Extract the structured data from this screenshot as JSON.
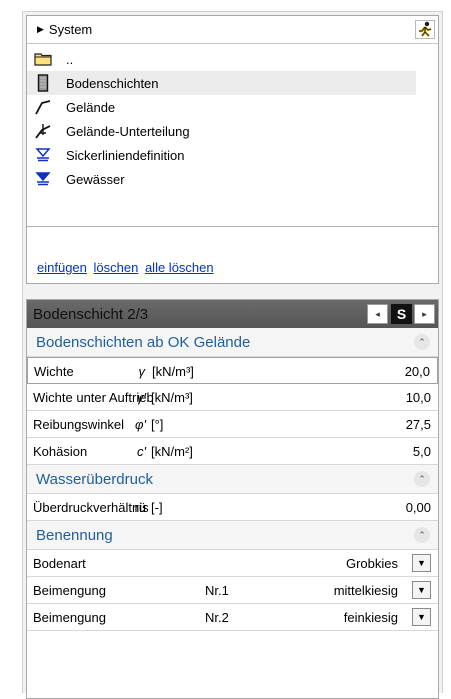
{
  "tree": {
    "root_label": "System",
    "items": [
      {
        "label": "..",
        "icon": "folder-icon"
      },
      {
        "label": "Bodenschichten",
        "icon": "soil-layer-icon"
      },
      {
        "label": "Gelände",
        "icon": "terrain-line-icon"
      },
      {
        "label": "Gelände-Unterteilung",
        "icon": "terrain-split-icon"
      },
      {
        "label": "Sickerliniendefinition",
        "icon": "seepage-line-icon"
      },
      {
        "label": "Gewässer",
        "icon": "water-level-icon"
      }
    ],
    "links": [
      "einfügen",
      "löschen",
      "alle löschen"
    ]
  },
  "props": {
    "title": "Bodenschicht  2/3",
    "nav_prev": "◂",
    "nav_s": "S",
    "nav_next": "▸",
    "sections": {
      "s1": "Bodenschichten ab OK Gelände",
      "s2": "Wasserüberdruck",
      "s3": "Benennung"
    },
    "rows": [
      {
        "label": "Wichte",
        "symbol": "γ",
        "unit": "[kN/m³]",
        "value": "20,0"
      },
      {
        "label": "Wichte unter Auftrieb",
        "symbol": "γ'",
        "unit": "[kN/m³]",
        "value": "10,0"
      },
      {
        "label": "Reibungswinkel",
        "symbol": "φ'",
        "unit": "[°]",
        "value": "27,5"
      },
      {
        "label": "Kohäsion",
        "symbol": "c'",
        "unit": "[kN/m²]",
        "value": "5,0"
      }
    ],
    "pressure": {
      "label": "Überdruckverhältnis",
      "symbol": "rü",
      "unit": "[-]",
      "value": "0,00"
    },
    "naming": [
      {
        "label": "Bodenart",
        "nr": "",
        "value": "Grobkies"
      },
      {
        "label": "Beimengung",
        "nr": "Nr.1",
        "value": "mittelkiesig"
      },
      {
        "label": "Beimengung",
        "nr": "Nr.2",
        "value": "feinkiesig"
      }
    ]
  }
}
